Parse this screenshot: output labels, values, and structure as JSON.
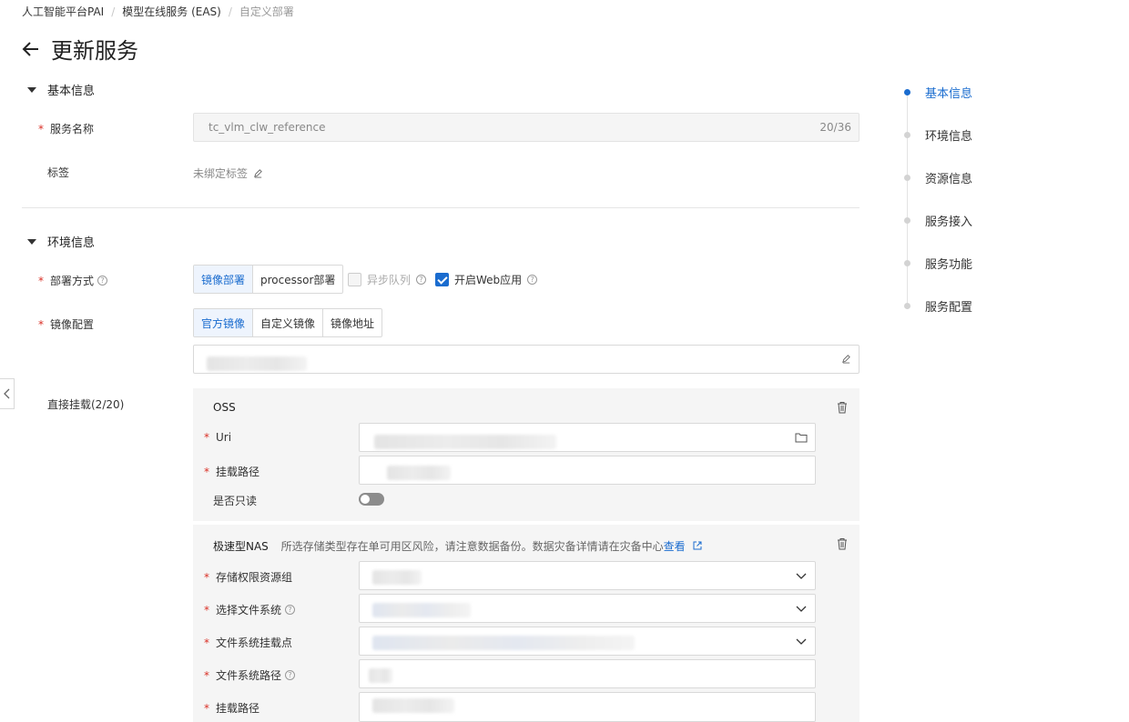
{
  "breadcrumb": [
    "人工智能平台PAI",
    "模型在线服务 (EAS)",
    "自定义部署"
  ],
  "page_title": "更新服务",
  "sections": {
    "basic": "基本信息",
    "env": "环境信息"
  },
  "basic": {
    "service_name_label": "服务名称",
    "service_name_value": "tc_vlm_clw_reference",
    "service_name_count": "20/36",
    "tags_label": "标签",
    "tags_value": "未绑定标签"
  },
  "env": {
    "deploy_label": "部署方式",
    "deploy_options": [
      "镜像部署",
      "processor部署"
    ],
    "async_queue": "异步队列",
    "web_app": "开启Web应用",
    "image_label": "镜像配置",
    "image_options": [
      "官方镜像",
      "自定义镜像",
      "镜像地址"
    ],
    "mount_label": "直接挂载(2/20)"
  },
  "oss": {
    "title": "OSS",
    "uri_label": "Uri",
    "mount_path_label": "挂载路径",
    "readonly_label": "是否只读",
    "readonly_on": false
  },
  "nas": {
    "title": "极速型NAS",
    "note": "所选存储类型存在单可用区风险，请注意数据备份。数据灾备详情请在灾备中心",
    "link": "查看",
    "perm_group_label": "存储权限资源组",
    "fs_label": "选择文件系统",
    "mount_point_label": "文件系统挂载点",
    "fs_path_label": "文件系统路径",
    "mount_path_label": "挂载路径"
  },
  "anchors": [
    "基本信息",
    "环境信息",
    "资源信息",
    "服务接入",
    "服务功能",
    "服务配置"
  ],
  "colors": {
    "accent": "#1a6ccf",
    "required": "#d93026"
  }
}
